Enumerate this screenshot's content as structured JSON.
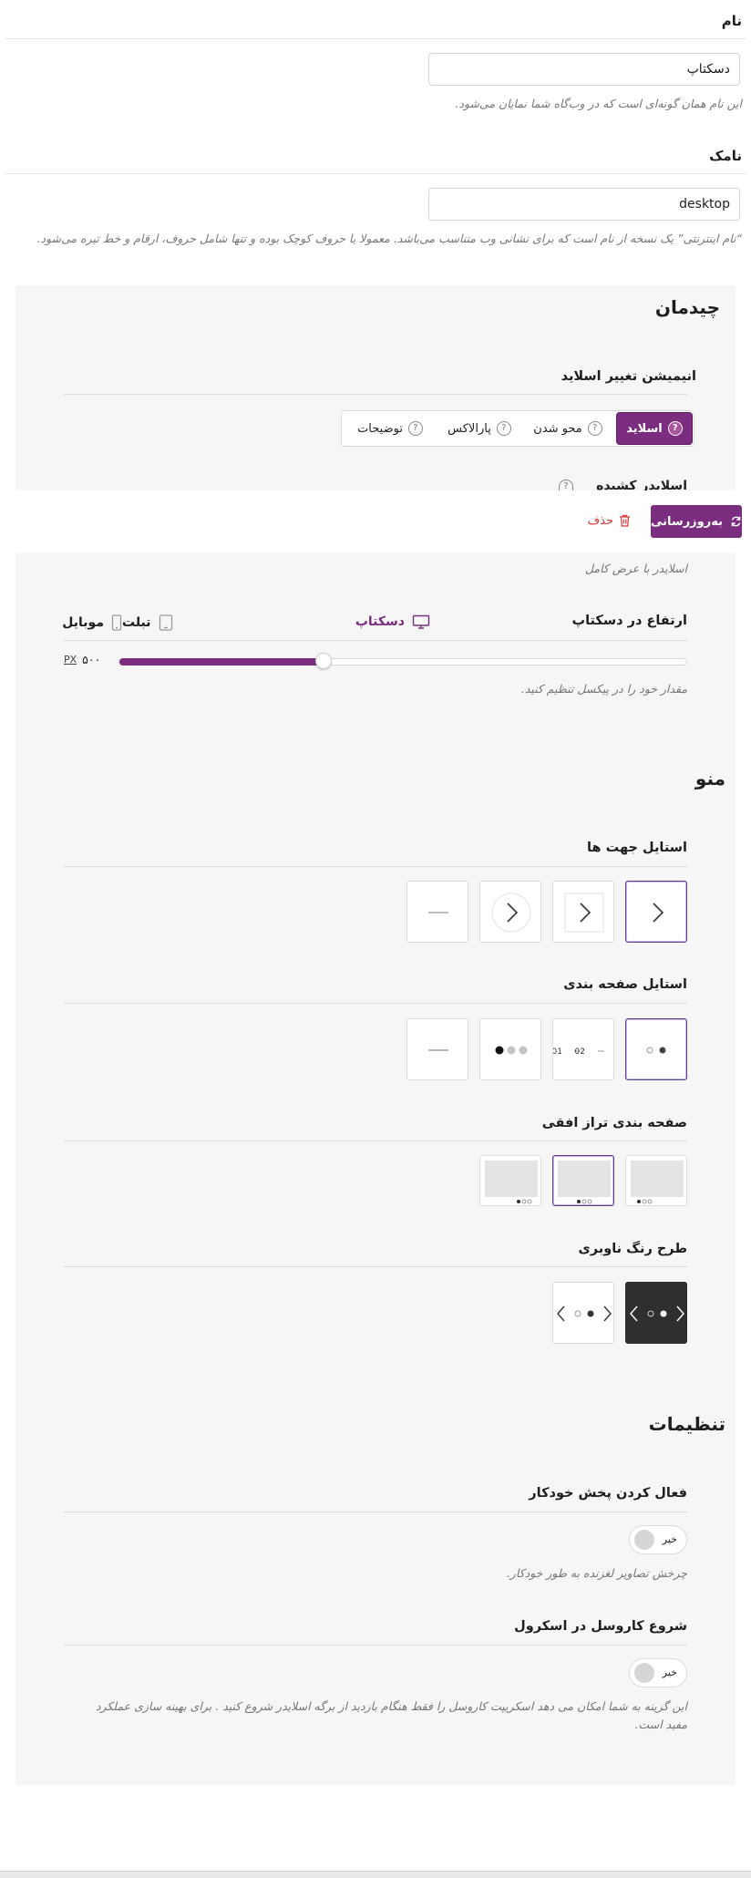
{
  "name_field": {
    "label": "نام",
    "value": "دسکتاپ",
    "help": "این نام همان گونه‌ای است که در وب‌گاه شما نمایان می‌شود."
  },
  "slug_field": {
    "label": "نامک",
    "value": "desktop",
    "help": "“نام اینترنتی” یک نسخه از نام است که برای نشانی وب متناسب می‌باشد. معمولا با حروف کوچک بوده و تنها شامل حروف، ارقام و خط تیره می‌شود."
  },
  "layout": {
    "title": "چیدمان",
    "animation_label": "انیمیشن تغییر اسلاید",
    "animation_options": [
      {
        "label": "اسلاید",
        "help_icon": "?"
      },
      {
        "label": "محو شدن",
        "help_icon": "?"
      },
      {
        "label": "پارالاکس",
        "help_icon": "?"
      },
      {
        "label": "توضیحات",
        "help_icon": "?"
      }
    ],
    "animation_selected": "اسلاید",
    "extended_label_partial": "اسلایدر کشیده",
    "extended_help": "اسلایدر با عرض کامل",
    "height_label": "ارتفاع در دسکتاپ",
    "devices": {
      "desktop": "دسکتاپ",
      "tablet": "تبلت",
      "mobile": "موبایل"
    },
    "height_value": "۵۰۰",
    "height_unit": "PX",
    "height_fraction": 0.36,
    "height_help": "مقدار خود را در پیکسل تنظیم کنید."
  },
  "toolbar": {
    "update_label": "به‌روزرسانی",
    "delete_label": "حذف"
  },
  "menu": {
    "title": "منو",
    "arrows_label": "استایل جهت ها",
    "pagination_label": "استایل صفحه بندی",
    "pagination_tile_labels": [
      "01",
      "02"
    ],
    "align_label": "صفحه بندی تراز افقی",
    "color_label": "طرح رنگ ناوبری"
  },
  "settings": {
    "title": "تنظیمات",
    "autoplay_label": "فعال کردن پخش خودکار",
    "autoplay_toggle": "خیر",
    "autoplay_help": "چرخش تصاویر لغزنده به طور خودکار.",
    "scroll_label": "شروع کاروسل در اسکرول",
    "scroll_toggle": "خیر",
    "scroll_help_line1": "این گزینه به شما امکان می دهد اسکریپت کاروسل را فقط هنگام بازدید از برگه اسلایدر شروع کنید . برای بهینه سازی عملکرد",
    "scroll_help_line2": "مفید است."
  },
  "colors": {
    "accent": "#7b2d7f",
    "selected_border": "#5c3e8f",
    "delete": "#d63638",
    "panel_bg": "#f6f6f6"
  }
}
